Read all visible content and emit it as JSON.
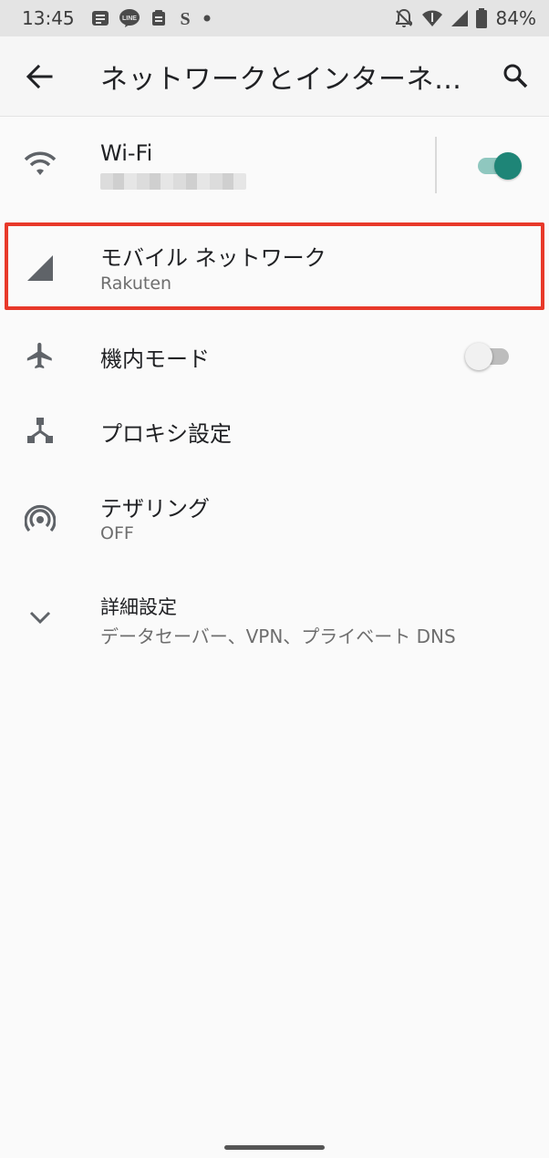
{
  "status_bar": {
    "time": "13:45",
    "left_icons": [
      "notes-icon",
      "line-app-icon",
      "clipboard-icon",
      "s-app-icon",
      "dot-icon"
    ],
    "battery": "84%"
  },
  "app_bar": {
    "title": "ネットワークとインターネ…"
  },
  "items": {
    "wifi": {
      "label": "Wi-Fi",
      "toggle_on": true
    },
    "mobile": {
      "label": "モバイル ネットワーク",
      "sub": "Rakuten"
    },
    "airplane": {
      "label": "機内モード",
      "toggle_on": false
    },
    "proxy": {
      "label": "プロキシ設定"
    },
    "tethering": {
      "label": "テザリング",
      "sub": "OFF"
    },
    "advanced": {
      "label": "詳細設定",
      "sub": "データセーバー、VPN、プライベート DNS"
    }
  },
  "colors": {
    "accent": "#1e8577",
    "accent_track": "#8fc7bf",
    "highlight": "#e8392a",
    "icon_gray": "#5f6368"
  }
}
